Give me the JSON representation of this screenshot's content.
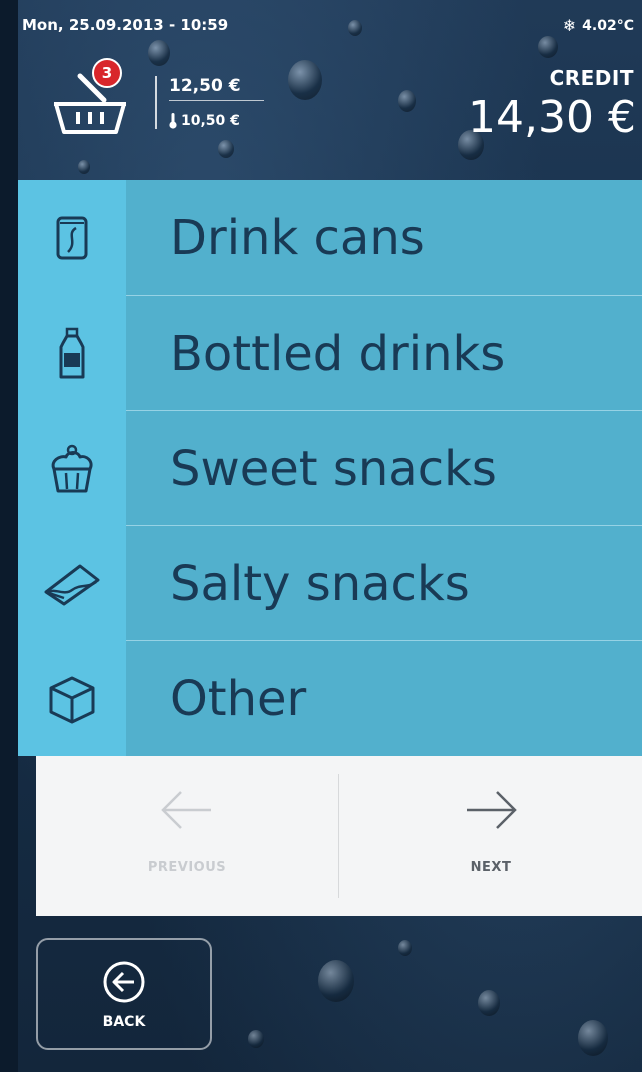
{
  "status": {
    "datetime": "Mon, 25.09.2013 - 10:59",
    "temperature": "4.02°C",
    "temperature_icon": "snowflake-icon"
  },
  "basket": {
    "icon": "basket-icon",
    "item_count": "3",
    "total": "12,50 €",
    "reduced_total": "10,50 €",
    "reduced_icon": "thermometer-icon"
  },
  "credit": {
    "label": "CREDIT",
    "value": "14,30 €"
  },
  "categories": [
    {
      "label": "Drink cans",
      "icon": "can-icon"
    },
    {
      "label": "Bottled drinks",
      "icon": "bottle-icon"
    },
    {
      "label": "Sweet snacks",
      "icon": "cupcake-icon"
    },
    {
      "label": "Salty snacks",
      "icon": "sandwich-icon"
    },
    {
      "label": "Other",
      "icon": "box-icon"
    }
  ],
  "pager": {
    "previous_label": "PREVIOUS",
    "next_label": "NEXT"
  },
  "back": {
    "label": "BACK"
  },
  "colors": {
    "list_bg": "#52b0cd",
    "icon_column_bg": "#5cc3e3",
    "label_text": "#193a55",
    "badge": "#d8262b"
  }
}
